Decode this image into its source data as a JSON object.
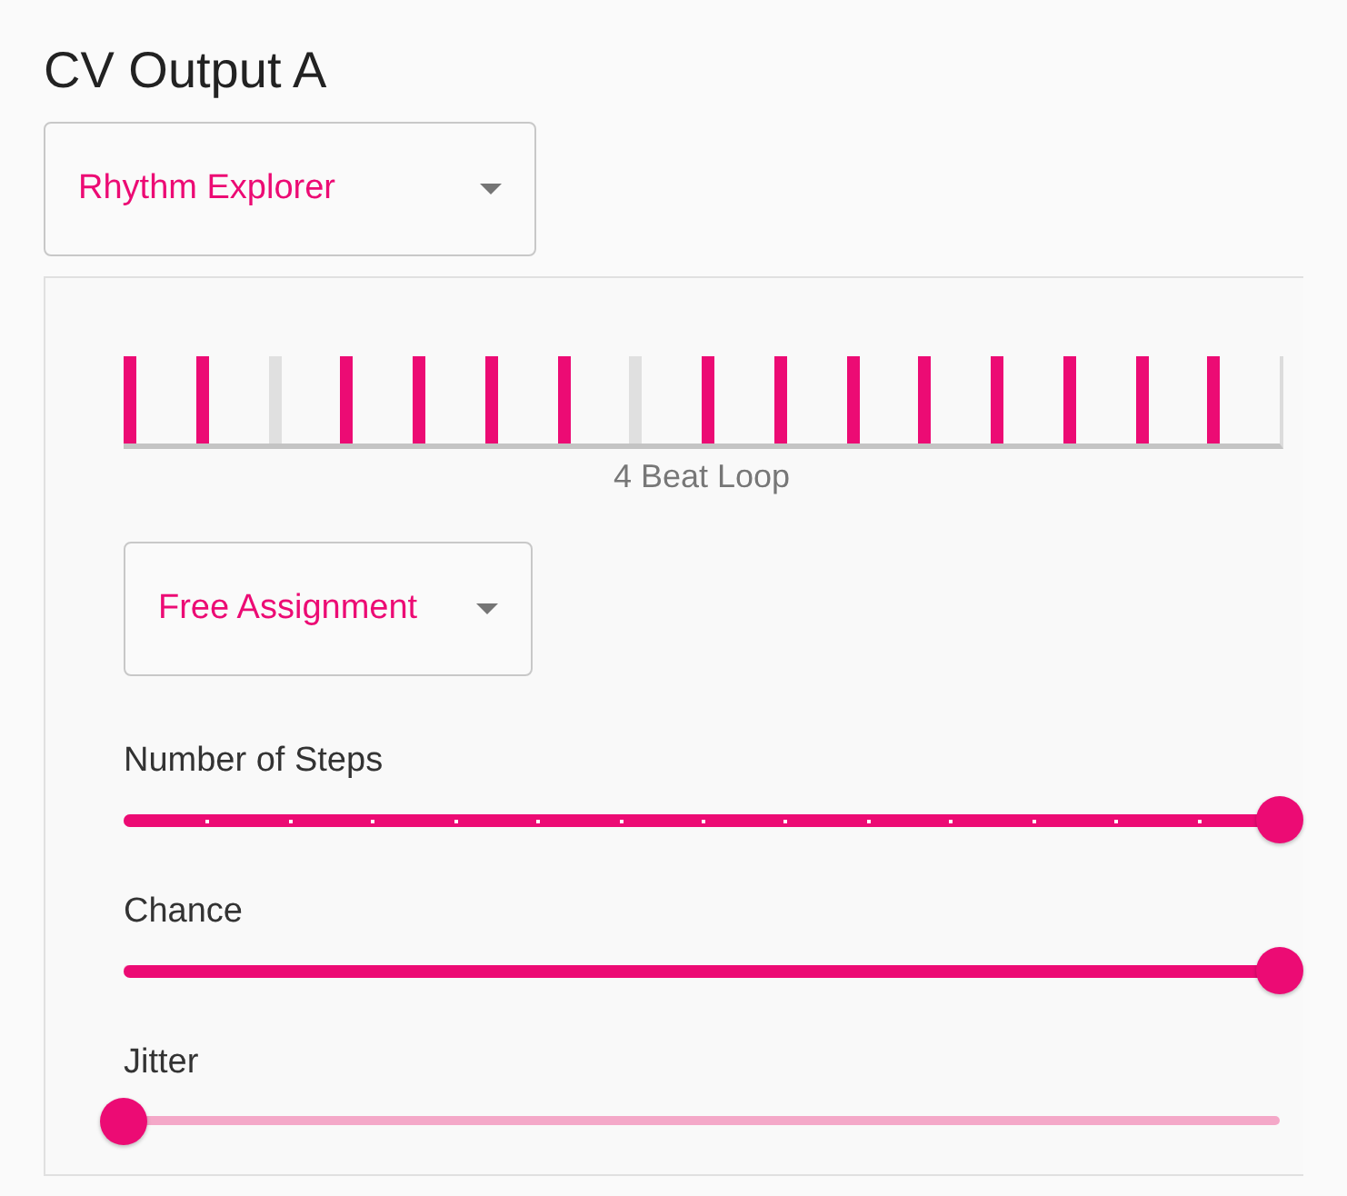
{
  "title": "CV Output A",
  "mode_select": {
    "value": "Rhythm Explorer"
  },
  "pattern": {
    "steps": [
      {
        "on": true
      },
      {
        "on": true
      },
      {
        "on": false
      },
      {
        "on": true
      },
      {
        "on": true
      },
      {
        "on": true
      },
      {
        "on": true
      },
      {
        "on": false
      },
      {
        "on": true
      },
      {
        "on": true
      },
      {
        "on": true
      },
      {
        "on": true
      },
      {
        "on": true
      },
      {
        "on": true
      },
      {
        "on": true
      },
      {
        "on": true
      }
    ],
    "caption": "4 Beat Loop"
  },
  "assignment_select": {
    "value": "Free Assignment"
  },
  "sliders": [
    {
      "label": "Number of Steps",
      "kind": "stepped",
      "level": 1
    },
    {
      "label": "Chance",
      "kind": "continuous",
      "level": 1
    },
    {
      "label": "Jitter",
      "kind": "continuous",
      "level": 0
    }
  ]
}
